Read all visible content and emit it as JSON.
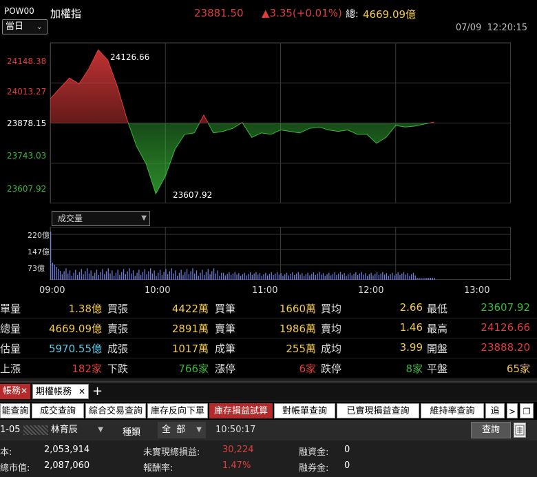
{
  "header": {
    "code": "POW00",
    "name": "加權指",
    "price": "23881.50",
    "change": "▲3.35(+0.01%)",
    "total_label": "總:",
    "total": "4669.09億",
    "period": "當日",
    "date": "07/09",
    "time": "12:20:15"
  },
  "colors": {
    "up": "#e23b3b",
    "down": "#39b739",
    "highlight": "#f2c94c",
    "estimate": "#5ccbe6",
    "active_tab": "#b52a2a"
  },
  "price_axis": {
    "labels": [
      "24148.38",
      "24013.27",
      "23878.15",
      "23743.03",
      "23607.92"
    ],
    "label_colors": [
      "#e23b3b",
      "#e23b3b",
      "#ffffff",
      "#39b739",
      "#39b739"
    ],
    "high_annotation": "24126.66",
    "low_annotation": "23607.92"
  },
  "volume_selector": "成交量",
  "volume_axis": {
    "labels": [
      "220億",
      "147億",
      "73億"
    ]
  },
  "time_axis": [
    "09:00",
    "10:00",
    "11:00",
    "12:00",
    "13:00"
  ],
  "chart_data": {
    "type": "area",
    "title": "",
    "reference_price": 23878.15,
    "ylim": [
      23607.92,
      24148.38
    ],
    "xlim": [
      "09:00",
      "13:00"
    ],
    "x_minutes_from_open": [
      0,
      5,
      10,
      15,
      20,
      25,
      30,
      35,
      40,
      45,
      50,
      55,
      60,
      65,
      70,
      75,
      80,
      85,
      90,
      95,
      100,
      105,
      110,
      115,
      120,
      125,
      130,
      135,
      140,
      145,
      150,
      155,
      160,
      165,
      170,
      175,
      180,
      185,
      190,
      195,
      200
    ],
    "price": [
      23960,
      23995,
      24030,
      24010,
      24060,
      24125,
      24090,
      24000,
      23890,
      23800,
      23740,
      23640,
      23700,
      23790,
      23840,
      23845,
      23905,
      23845,
      23850,
      23860,
      23880,
      23830,
      23845,
      23840,
      23855,
      23850,
      23845,
      23860,
      23865,
      23855,
      23850,
      23855,
      23840,
      23840,
      23810,
      23830,
      23870,
      23865,
      23868,
      23875,
      23881.5
    ],
    "volume_series": {
      "name": "成交量",
      "unit": "億",
      "ylim": [
        0,
        220
      ]
    }
  },
  "stats": [
    [
      {
        "label": "單量",
        "value": "1.38億",
        "color": "yellow"
      },
      {
        "label": "買張",
        "value": "4422萬",
        "color": "yellow"
      },
      {
        "label": "買筆",
        "value": "1660萬",
        "color": "yellow"
      },
      {
        "label": "買均",
        "value": "2.66",
        "color": "yellow"
      },
      {
        "label": "最低",
        "value": "23607.92",
        "color": "green"
      }
    ],
    [
      {
        "label": "總量",
        "value": "4669.09億",
        "color": "yellow"
      },
      {
        "label": "賣張",
        "value": "2891萬",
        "color": "yellow"
      },
      {
        "label": "賣筆",
        "value": "1986萬",
        "color": "yellow"
      },
      {
        "label": "賣均",
        "value": "1.46",
        "color": "yellow"
      },
      {
        "label": "最高",
        "value": "24126.66",
        "color": "red"
      }
    ],
    [
      {
        "label": "估量",
        "value": "5970.55億",
        "color": "cyan"
      },
      {
        "label": "成張",
        "value": "1017萬",
        "color": "yellow"
      },
      {
        "label": "成筆",
        "value": "255萬",
        "color": "yellow"
      },
      {
        "label": "成均",
        "value": "3.99",
        "color": "yellow"
      },
      {
        "label": "開盤",
        "value": "23888.20",
        "color": "red"
      }
    ],
    [
      {
        "label": "上漲",
        "value": "182家",
        "color": "red"
      },
      {
        "label": "下跌",
        "value": "766家",
        "color": "green"
      },
      {
        "label": "漲停",
        "value": "6家",
        "color": "red"
      },
      {
        "label": "跌停",
        "value": "8家",
        "color": "green"
      },
      {
        "label": "平盤",
        "value": "65家",
        "color": "yellow"
      }
    ]
  ],
  "account_tabs": [
    {
      "label": "帳務",
      "close": "✕",
      "active": true
    },
    {
      "label": "期權帳務",
      "close": "✕",
      "active": false
    }
  ],
  "add_tab": "+",
  "function_tabs": [
    "能查詢",
    "成交查詢",
    "綜合交易查詢",
    "庫存反向下單",
    "庫存損益試算",
    "對帳單查詢",
    "已實現損益查詢",
    "維持率查詢",
    "追"
  ],
  "active_function_tab": 4,
  "nav": {
    "right": ">",
    "restore": "❐"
  },
  "filter": {
    "account": "1-05",
    "account_name": "林育辰",
    "type_label": "種類",
    "type_value": "全  部",
    "time": "10:50:17",
    "query": "查詢"
  },
  "summary": {
    "cost_label": "本:",
    "cost_value": "2,053,914",
    "market_label": "總市值:",
    "market_value": "2,087,060",
    "unrealized_label": "未實現總損益:",
    "unrealized_value": "30,224",
    "return_label": "報酬率:",
    "return_value": "1.47%",
    "margin_label": "融資金:",
    "margin_value": "0",
    "short_label": "融券金:",
    "short_value": "0"
  }
}
